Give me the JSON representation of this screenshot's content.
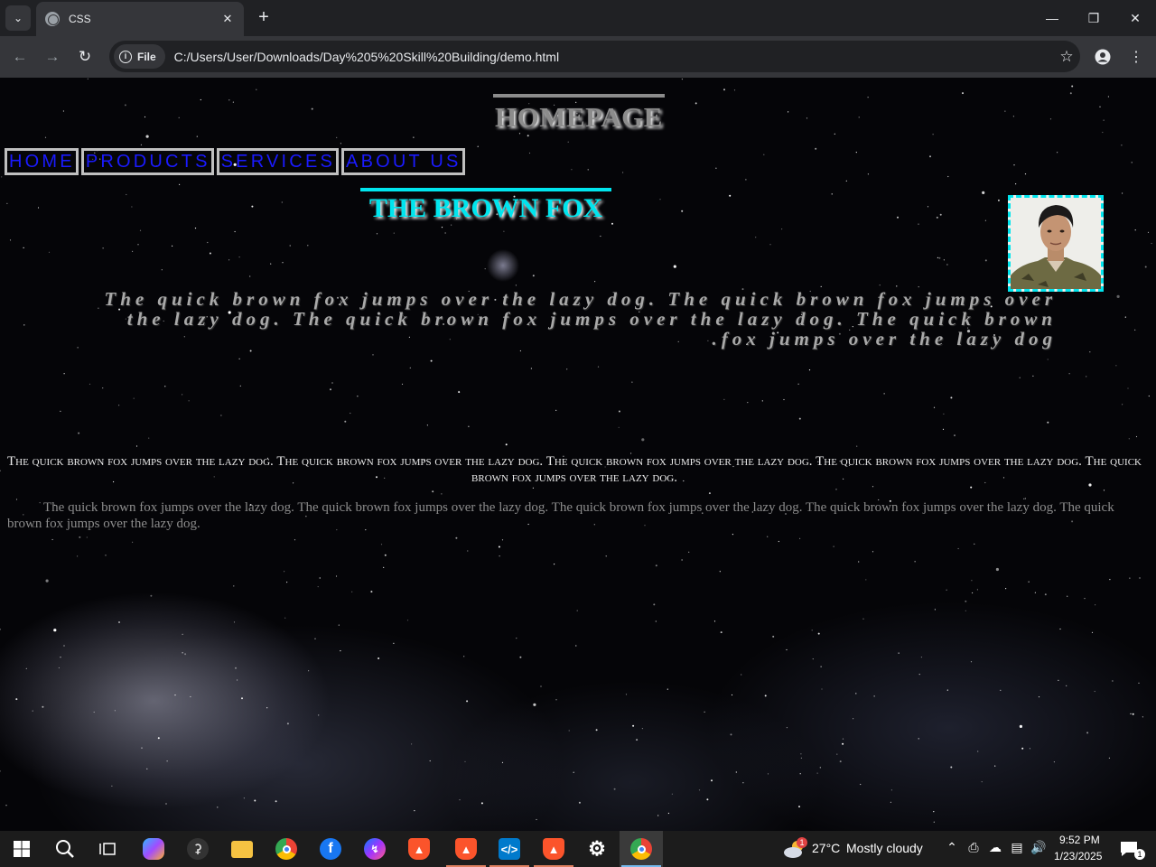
{
  "browser": {
    "tab_title": "CSS",
    "address_chip": "File",
    "url": "C:/Users/User/Downloads/Day%205%20Skill%20Building/demo.html"
  },
  "page": {
    "homepage_heading": "HOMEPAGE",
    "nav": [
      "HOME",
      "PRODUCTS",
      "SERVICES",
      "ABOUT US"
    ],
    "section_heading": "THE BROWN FOX",
    "italic_paragraph": "The quick brown fox jumps over the lazy dog. The quick brown fox jumps over the lazy dog. The quick brown fox jumps over the lazy dog. The quick brown fox jumps over the lazy dog.",
    "smallcaps_paragraph": "The quick brown fox jumps over the lazy dog. The quick brown fox jumps over the lazy dog. The quick brown fox jumps over the lazy dog. The quick brown fox jumps over the lazy dog. The quick brown fox jumps over the lazy dog.",
    "plain_paragraph": "The quick brown fox jumps over the lazy dog. The quick brown fox jumps over the lazy dog. The quick brown fox jumps over the lazy dog. The quick brown fox jumps over the lazy dog. The quick brown fox jumps over the lazy dog."
  },
  "colors": {
    "nav_text": "#1a1aff",
    "accent_cyan": "#00e5ee",
    "heading_gray": "#8c8c8c"
  },
  "taskbar": {
    "weather_badge": "1",
    "weather_temp": "27°C",
    "weather_text": "Mostly cloudy",
    "time": "9:52 PM",
    "date": "1/23/2025",
    "notification_count": "1"
  }
}
